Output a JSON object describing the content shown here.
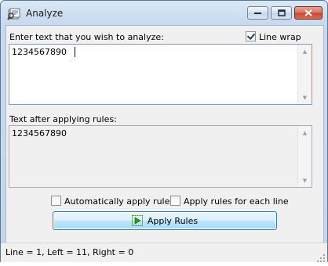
{
  "window": {
    "title": "Analyze"
  },
  "caption_buttons": {
    "minimize_icon": "minimize-icon",
    "maximize_icon": "maximize-icon",
    "close_icon": "close-icon"
  },
  "input_section": {
    "label": "Enter text that you wish to analyze:",
    "line_wrap_label": "Line wrap",
    "line_wrap_checked": true,
    "text": "1234567890"
  },
  "output_section": {
    "label": "Text after applying rules:",
    "text": "1234567890"
  },
  "options": {
    "auto_apply_label": "Automatically apply rules",
    "auto_apply_checked": false,
    "each_line_label": "Apply rules for each line",
    "each_line_checked": false
  },
  "apply_button": {
    "label": "Apply Rules",
    "icon": "play-icon"
  },
  "status": {
    "text": "Line = 1, Left = 11, Right = 0"
  },
  "colors": {
    "title_bar": "#c7d9ee",
    "close_button": "#c7452c",
    "button_border": "#3c7fb1"
  }
}
